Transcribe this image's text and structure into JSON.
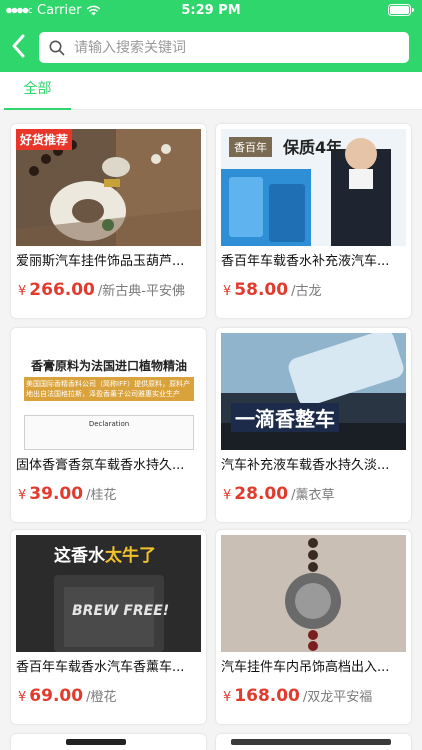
{
  "status": {
    "carrier": "Carrier",
    "time": "5:29 PM"
  },
  "search": {
    "placeholder": "请输入搜索关键词"
  },
  "tabs": [
    {
      "label": "全部"
    }
  ],
  "products": [
    {
      "title": "爱丽斯汽车挂件饰品玉葫芦...",
      "yen": "¥",
      "price": "266.00",
      "tag": "/新古典-平安佛",
      "image_badge": "好货推荐"
    },
    {
      "title": "香百年车载香水补充液汽车...",
      "yen": "¥",
      "price": "58.00",
      "tag": "/古龙",
      "image_brand": "香百年",
      "image_slogan": "保质4年"
    },
    {
      "title": "固体香膏香氛车载香水持久...",
      "yen": "¥",
      "price": "39.00",
      "tag": "/桂花",
      "image_headline": "香膏原料为法国进口植物精油",
      "image_subtext": "美国国际香精香料公司（简称IFF）提供原料，原料产地出自法国格拉斯，泽盈香薰子公司雅惠实业生产",
      "image_doc_title": "Declaration"
    },
    {
      "title": "汽车补充液车载香水持久淡...",
      "yen": "¥",
      "price": "28.00",
      "tag": "/薰衣草",
      "image_banner": "一滴香整车"
    },
    {
      "title": "香百年车载香水汽车香薰车...",
      "yen": "¥",
      "price": "69.00",
      "tag": "/橙花",
      "image_headline_a": "这香水",
      "image_headline_b": "太牛了",
      "image_can_text": "BREW FREE!"
    },
    {
      "title": "汽车挂件车内吊饰高档出入...",
      "yen": "¥",
      "price": "168.00",
      "tag": "/双龙平安福"
    }
  ],
  "colors": {
    "accent": "#2fd66c",
    "price": "#e23b2e"
  }
}
